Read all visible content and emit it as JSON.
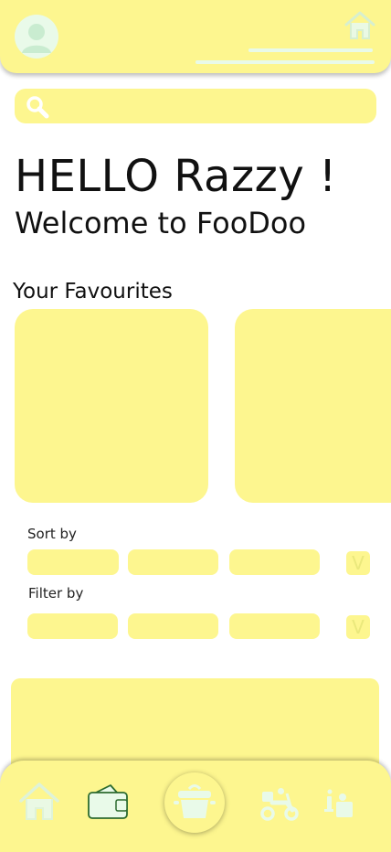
{
  "greeting": {
    "hello": "HELLO Razzy !",
    "welcome": "Welcome to FooDoo"
  },
  "favourites": {
    "title": "Your Favourites"
  },
  "sort": {
    "label": "Sort by",
    "dropdown_glyph": "V"
  },
  "filter": {
    "label": "Filter by",
    "dropdown_glyph": "V"
  },
  "icons": {
    "header_left": "user-avatar-icon",
    "header_right": "home-icon",
    "search": "search-icon",
    "nav": [
      "home-icon",
      "wallet-icon",
      "cooking-pot-icon",
      "delivery-scooter-icon",
      "info-person-icon"
    ]
  },
  "colors": {
    "accent": "#fdf68f",
    "icon_mint": "#e9fae9",
    "text": "#111111"
  }
}
